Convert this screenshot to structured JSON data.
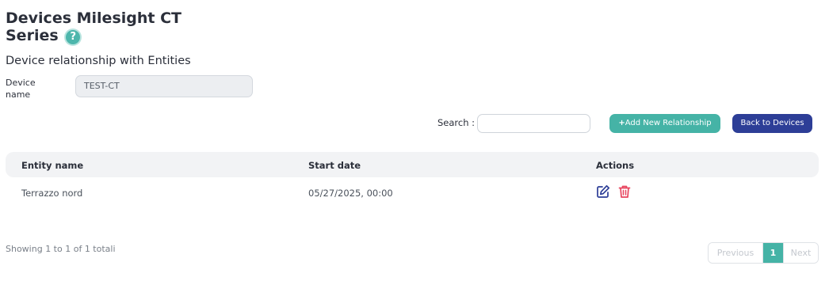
{
  "page": {
    "title_line1": "Devices Milesight CT",
    "title_line2": "Series",
    "help_glyph": "?",
    "subtitle": "Device relationship with Entities"
  },
  "device": {
    "label": "Device name",
    "value": "TEST-CT"
  },
  "toolbar": {
    "search_label": "Search :",
    "search_value": "",
    "add_label": "Add New Relationship",
    "add_icon": "+",
    "back_label": "Back to Devices"
  },
  "table": {
    "columns": [
      "Entity name",
      "Start date",
      "Actions"
    ],
    "rows": [
      {
        "entity_name": "Terrazzo nord",
        "start_date": "05/27/2025, 00:00"
      }
    ]
  },
  "footer": {
    "showing": "Showing 1 to 1 of 1 totali",
    "previous": "Previous",
    "page": "1",
    "next": "Next"
  },
  "colors": {
    "accent": "#45b3a6",
    "primary": "#2d3e97",
    "delete": "#e8455f"
  }
}
